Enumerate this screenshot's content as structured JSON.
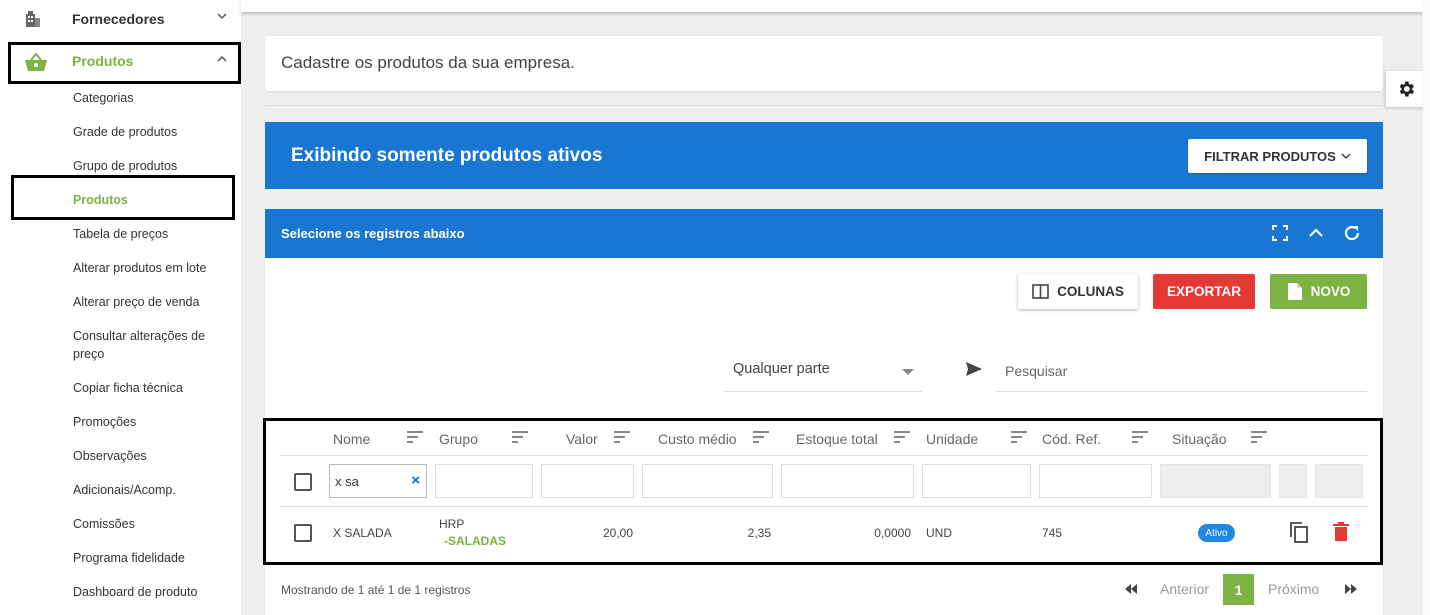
{
  "sidebar": {
    "top_item": {
      "label": "Fornecedores",
      "icon": "building-icon"
    },
    "products": {
      "label": "Produtos",
      "icon": "basket-icon",
      "accent": "#7cb342"
    },
    "sub_items": [
      {
        "label": "Categorias"
      },
      {
        "label": "Grade de produtos"
      },
      {
        "label": "Grupo de produtos"
      },
      {
        "label": "Produtos",
        "active": true
      },
      {
        "label": "Tabela de preços"
      },
      {
        "label": "Alterar produtos em lote"
      },
      {
        "label": "Alterar preço de venda"
      },
      {
        "label": "Consultar alterações de"
      },
      {
        "label": "preço"
      },
      {
        "label": "Copiar ficha técnica"
      },
      {
        "label": "Promoções"
      },
      {
        "label": "Observações"
      },
      {
        "label": "Adicionais/Acomp."
      },
      {
        "label": "Comissões"
      },
      {
        "label": "Programa fidelidade"
      },
      {
        "label": "Dashboard de produto"
      }
    ]
  },
  "header": {
    "description": "Cadastre os produtos da sua empresa."
  },
  "banner": {
    "title": "Exibindo somente produtos ativos",
    "filter_label": "FILTRAR PRODUTOS",
    "color": "#1976d2"
  },
  "panel": {
    "title": "Selecione os registros abaixo",
    "columns_label": "COLUNAS",
    "export_label": "EXPORTAR",
    "new_label": "NOVO",
    "search_mode": "Qualquer parte",
    "search_placeholder": "Pesquisar"
  },
  "table": {
    "headers": [
      "Nome",
      "Grupo",
      "Valor",
      "Custo médio",
      "Estoque total",
      "Unidade",
      "Cód. Ref.",
      "Situação"
    ],
    "filter_name": "x sa",
    "rows": [
      {
        "nome": "X SALADA",
        "grupo_top": "HRP",
        "grupo_bottom": "-SALADAS",
        "valor": "20,00",
        "custo": "2,35",
        "estoque": "0,0000",
        "unidade": "UND",
        "cod_ref": "745",
        "situacao": "Ativo"
      }
    ]
  },
  "footer": {
    "summary": "Mostrando de 1 até 1 de 1 registros",
    "prev": "Anterior",
    "next": "Próximo",
    "page": "1"
  }
}
